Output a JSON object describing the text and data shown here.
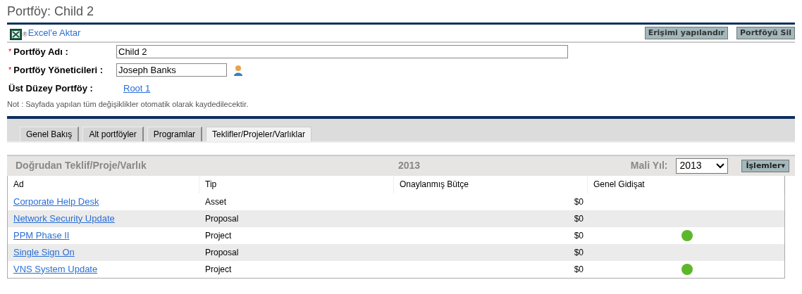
{
  "page_title": "Portföy: Child 2",
  "export_mark": "®",
  "export_link": "Excel'e Aktar",
  "required_mark": "*",
  "buttons": [
    "Erişimi yapılandır",
    "Portföyü Sil"
  ],
  "fields": [
    {
      "kind": "text",
      "label": "Portföy Adı :",
      "required": true,
      "value": "Child 2"
    },
    {
      "kind": "user",
      "label": "Portföy Yöneticileri :",
      "required": true,
      "value": "Joseph Banks"
    },
    {
      "kind": "link",
      "label": "Üst Düzey Portföy :",
      "required": false,
      "value": "Root 1"
    }
  ],
  "note": "Not : Sayfada yapılan tüm değişiklikler otomatik olarak kaydedilecektir.",
  "tabs": [
    {
      "label": "Genel Bakış",
      "selected": false
    },
    {
      "label": "Alt portföyler",
      "selected": false
    },
    {
      "label": "Programlar",
      "selected": false
    },
    {
      "label": "Teklifler/Projeler/Varlıklar",
      "selected": true
    }
  ],
  "section": {
    "title": "Doğrudan Teklif/Proje/Varlık",
    "year": "2013",
    "fiscal_year_label": "Mali Yıl:",
    "fiscal_year_value": "2013",
    "actions_button": "İşlemler▾"
  },
  "table": {
    "columns": [
      "Ad",
      "Tip",
      "Onaylanmış Bütçe",
      "Genel Gidişat"
    ],
    "rows": [
      {
        "name": "Corporate Help Desk",
        "type": "Asset",
        "budget": "$0"
      },
      {
        "name": "Network Security Update",
        "type": "Proposal",
        "budget": "$0"
      },
      {
        "name": "PPM Phase II",
        "type": "Project",
        "budget": "$0",
        "color": "#5cb82a"
      },
      {
        "name": "Single Sign On",
        "type": "Proposal",
        "budget": "$0"
      },
      {
        "name": "VNS System Update",
        "type": "Project",
        "budget": "$0",
        "color": "#5cb82a"
      }
    ]
  }
}
